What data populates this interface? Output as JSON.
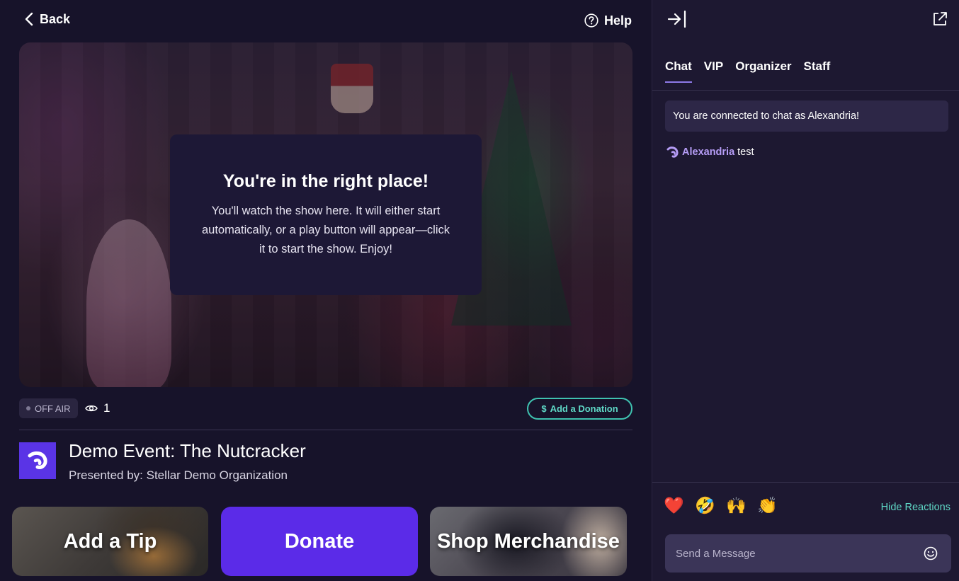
{
  "header": {
    "back_label": "Back",
    "help_label": "Help"
  },
  "video": {
    "overlay_title": "You're in the right place!",
    "overlay_text": "You'll watch the show here. It will either start automatically, or a play button will appear—click it to start the show. Enjoy!"
  },
  "status": {
    "live_status": "OFF AIR",
    "viewer_count": "1",
    "donation_button_label": "Add a Donation",
    "donation_icon": "$"
  },
  "event": {
    "title": "Demo Event: The Nutcracker",
    "presenter": "Presented by: Stellar Demo Organization"
  },
  "actions": [
    {
      "label": "Add a Tip"
    },
    {
      "label": "Donate"
    },
    {
      "label": "Shop Merchandise"
    }
  ],
  "chat": {
    "tabs": [
      {
        "label": "Chat",
        "active": true
      },
      {
        "label": "VIP",
        "active": false
      },
      {
        "label": "Organizer",
        "active": false
      },
      {
        "label": "Staff",
        "active": false
      }
    ],
    "system_message": "You are connected to chat as Alexandria!",
    "messages": [
      {
        "username": "Alexandria",
        "text": "test"
      }
    ],
    "reactions": [
      "❤️",
      "🤣",
      "🙌",
      "👏"
    ],
    "hide_reactions_label": "Hide Reactions",
    "input_placeholder": "Send a Message"
  },
  "colors": {
    "background": "#17132a",
    "panel": "#1d1831",
    "accent_purple": "#5b2be8",
    "accent_teal": "#5fd8c6",
    "username": "#b59cf5"
  }
}
